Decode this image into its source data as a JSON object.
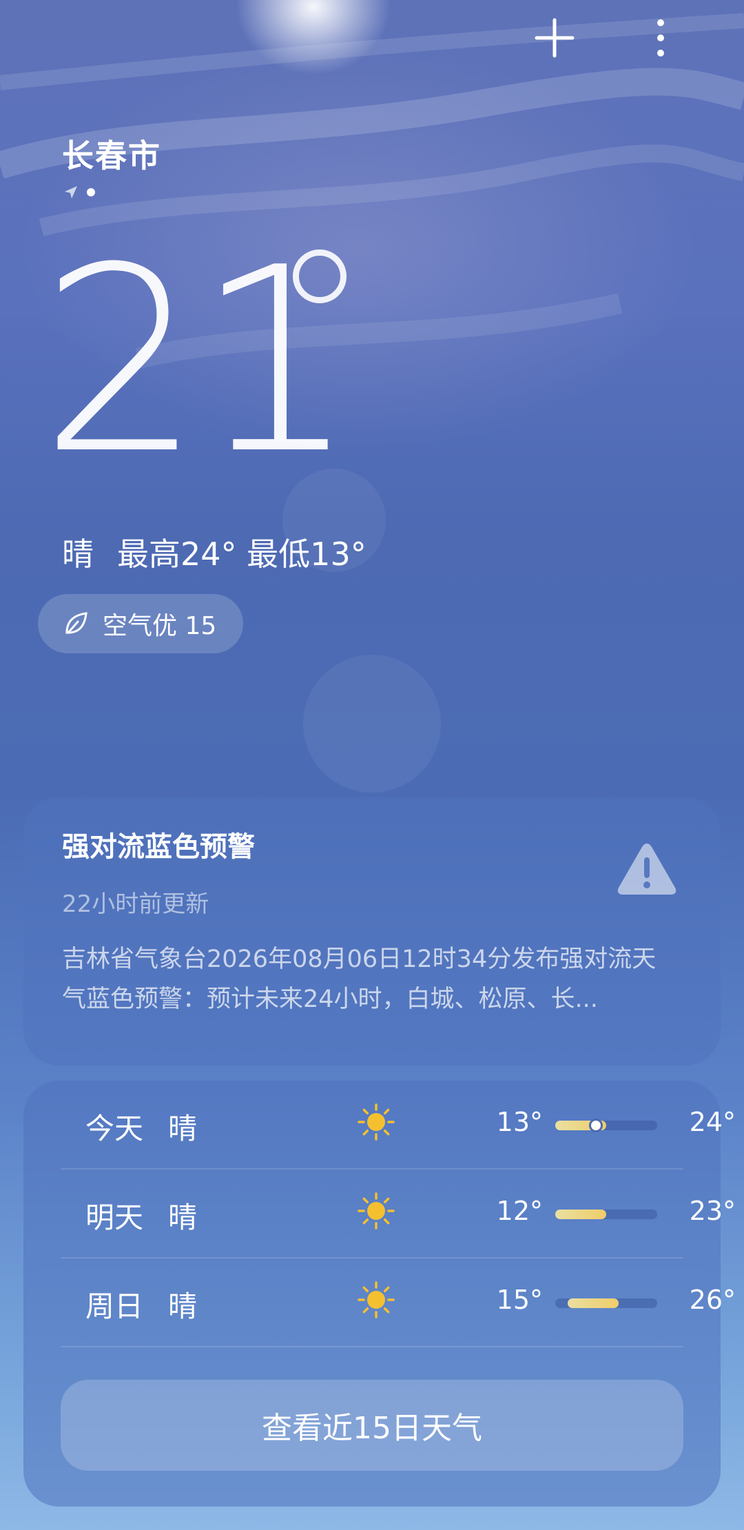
{
  "header": {
    "city": "长春市"
  },
  "current": {
    "temperature": "21",
    "condition": "晴",
    "high": "最高24°",
    "low": "最低13°",
    "aqi": "空气优 15"
  },
  "alert": {
    "title": "强对流蓝色预警",
    "updated": "22小时前更新",
    "body": "吉林省气象台2026年08月06日12时34分发布强对流天气蓝色预警：预计未来24小时，白城、松原、长..."
  },
  "forecast": {
    "days": [
      {
        "day": "今天",
        "cond": "晴",
        "low": "13°",
        "high": "24°",
        "bar_start": 0.0,
        "bar_end": 0.5,
        "current_marker": 0.33
      },
      {
        "day": "明天",
        "cond": "晴",
        "low": "12°",
        "high": "23°",
        "bar_start": 0.0,
        "bar_end": 0.5
      },
      {
        "day": "周日",
        "cond": "晴",
        "low": "15°",
        "high": "26°",
        "bar_start": 0.12,
        "bar_end": 0.62
      }
    ],
    "more_label": "查看近15日天气"
  },
  "icons": {
    "add": "plus-icon",
    "more": "more-vertical-icon",
    "location": "location-arrow-icon",
    "aqi": "leaf-icon",
    "alert": "warning-triangle-icon",
    "weather": "sun-icon"
  },
  "colors": {
    "bar": "#f0cc6a",
    "sun": "#f5c02f"
  }
}
